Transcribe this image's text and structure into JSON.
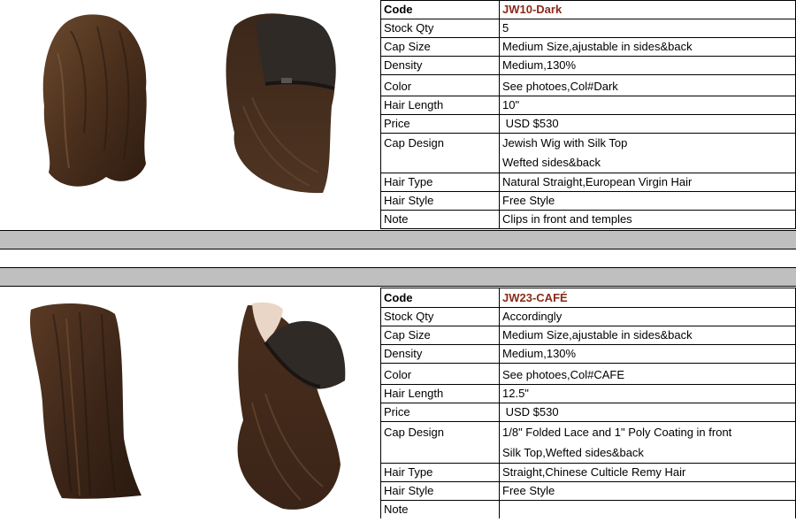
{
  "products": [
    {
      "code_label": "Code",
      "code_value": "JW10-Dark",
      "rows": [
        {
          "key": "Stock Qty",
          "value": "5"
        },
        {
          "key": "Cap Size",
          "value": "Medium Size,ajustable in sides&back"
        },
        {
          "key": "Density",
          "value": "Medium,130%"
        },
        {
          "key": "Color",
          "value": "See photoes,Col#Dark"
        },
        {
          "key": "Hair Length",
          "value": "10\""
        },
        {
          "key": "Price",
          "value": " USD $530"
        },
        {
          "key": "Cap Design",
          "value": "Jewish Wig with Silk Top",
          "value2": "Wefted sides&back"
        },
        {
          "key": "Hair Type",
          "value": "Natural Straight,European Virgin Hair"
        },
        {
          "key": "Hair Style",
          "value": "Free Style"
        },
        {
          "key": "Note",
          "value": "Clips in front and temples"
        }
      ]
    },
    {
      "code_label": "Code",
      "code_value": "JW23-CAFÉ",
      "rows": [
        {
          "key": "Stock Qty",
          "value": "Accordingly"
        },
        {
          "key": "Cap Size",
          "value": "Medium Size,ajustable in sides&back"
        },
        {
          "key": "Density",
          "value": "Medium,130%"
        },
        {
          "key": "Color",
          "value": "See photoes,Col#CAFE"
        },
        {
          "key": "Hair Length",
          "value": "12.5\""
        },
        {
          "key": "Price",
          "value": " USD $530"
        },
        {
          "key": "Cap Design",
          "value": "1/8\" Folded Lace and 1\" Poly Coating in front",
          "value2": "Silk Top,Wefted sides&back"
        },
        {
          "key": "Hair Type",
          "value": "Straight,Chinese Culticle Remy Hair"
        },
        {
          "key": "Hair Style",
          "value": "Free Style"
        },
        {
          "key": "Note",
          "value": ""
        }
      ]
    }
  ],
  "colors": {
    "code_text": "#8b2a1a",
    "separator": "#bfbfbf",
    "hair_dark": "#3a2417",
    "hair_mid": "#5a3a24",
    "cap_inner": "#2f2a26",
    "silk_top": "#e9d6c6"
  }
}
